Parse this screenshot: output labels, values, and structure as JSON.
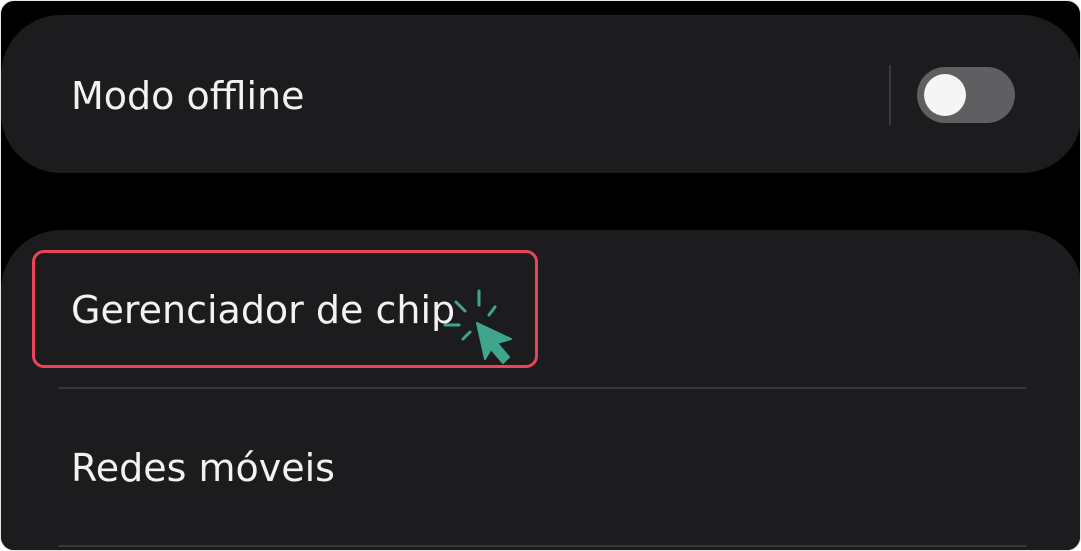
{
  "settings": {
    "items": [
      {
        "label": "Modo offline",
        "toggle_state": "off"
      },
      {
        "label": "Gerenciador de chip"
      },
      {
        "label": "Redes móveis"
      }
    ]
  },
  "colors": {
    "background": "#000000",
    "card": "#1c1c1e",
    "text": "#f2f2f2",
    "toggle_track": "#5f5f62",
    "toggle_knob": "#f5f5f5",
    "highlight": "#e9445a",
    "cursor": "#3fa58c"
  },
  "icons": {
    "click_cursor": "pointer-click-icon"
  }
}
